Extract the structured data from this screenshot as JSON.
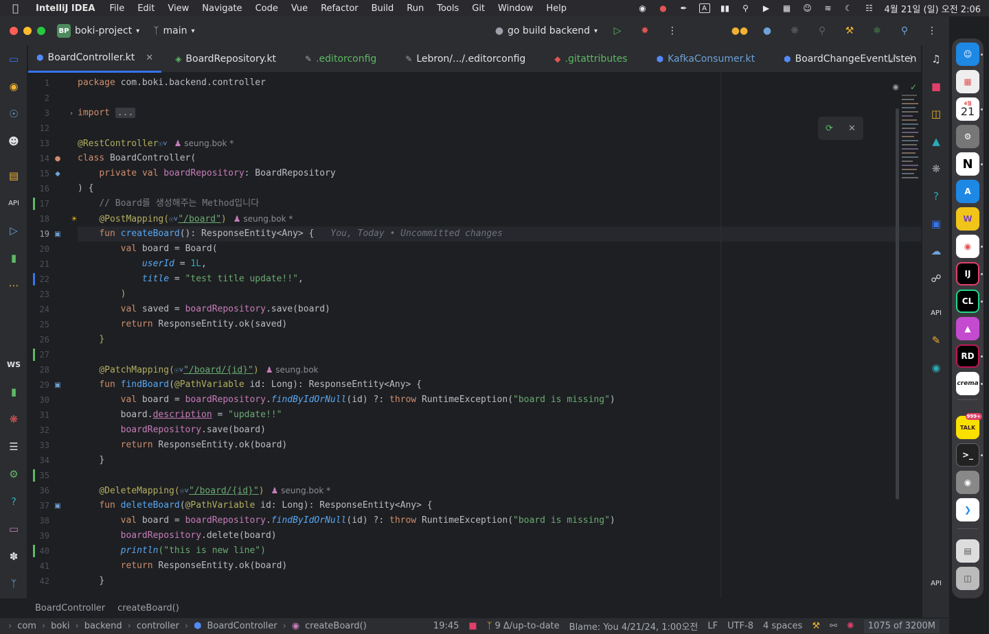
{
  "menubar": {
    "app_name": "IntelliJ IDEA",
    "items": [
      "File",
      "Edit",
      "View",
      "Navigate",
      "Code",
      "Vue",
      "Refactor",
      "Build",
      "Run",
      "Tools",
      "Git",
      "Window",
      "Help"
    ],
    "datetime": "4월 21일 (일) 오전 2:06"
  },
  "titlebar": {
    "project_badge": "BP",
    "project_name": "boki-project",
    "branch": "main",
    "run_config": "go build backend"
  },
  "tabs": [
    {
      "label": "BoardController.kt",
      "icon": "kotlin-class-icon",
      "active": true,
      "color": "#548af7"
    },
    {
      "label": "BoardRepository.kt",
      "icon": "kotlin-interface-icon",
      "active": false,
      "color": "#5fb865"
    },
    {
      "label": ".editorconfig",
      "icon": "editorconfig-icon",
      "active": false,
      "color": "#9da0a8"
    },
    {
      "label": "Lebron/.../.editorconfig",
      "icon": "editorconfig-icon",
      "active": false,
      "color": "#9da0a8"
    },
    {
      "label": ".gitattributes",
      "icon": "git-file-icon",
      "active": false,
      "color": "#e05555"
    },
    {
      "label": "KafkaConsumer.kt",
      "icon": "kotlin-class-icon",
      "active": false,
      "color": "#548af7"
    },
    {
      "label": "BoardChangeEventListen",
      "icon": "kotlin-class-icon",
      "active": false,
      "color": "#548af7"
    }
  ],
  "code": {
    "current_line": "19",
    "author": "seung.bok",
    "author_mod": "seung.bok *",
    "blame_inline": "You, Today • Uncommitted changes",
    "lines": [
      {
        "n": "1"
      },
      {
        "n": "2"
      },
      {
        "n": "3"
      },
      {
        "n": "12"
      },
      {
        "n": "13"
      },
      {
        "n": "14"
      },
      {
        "n": "15"
      },
      {
        "n": "16"
      },
      {
        "n": "17"
      },
      {
        "n": "18"
      },
      {
        "n": "19"
      },
      {
        "n": "20"
      },
      {
        "n": "21"
      },
      {
        "n": "22"
      },
      {
        "n": "23"
      },
      {
        "n": "24"
      },
      {
        "n": "25"
      },
      {
        "n": "26"
      },
      {
        "n": "27"
      },
      {
        "n": "28"
      },
      {
        "n": "29"
      },
      {
        "n": "30"
      },
      {
        "n": "31"
      },
      {
        "n": "32"
      },
      {
        "n": "33"
      },
      {
        "n": "34"
      },
      {
        "n": "35"
      },
      {
        "n": "36"
      },
      {
        "n": "37"
      },
      {
        "n": "38"
      },
      {
        "n": "39"
      },
      {
        "n": "40"
      },
      {
        "n": "41"
      },
      {
        "n": "42"
      }
    ],
    "t": {
      "package_kw": "package",
      "package_name": " com.boki.backend.controller",
      "import_kw": "import",
      "fold": "...",
      "rest_controller": "@RestController",
      "class_kw": "class",
      "class_name": " BoardController(",
      "private_kw": "private",
      "val_kw": "val",
      "repo_prop": "boardRepository",
      "repo_type": ": BoardRepository",
      "close_brace_open": ") {",
      "comment": "// Board를 생성해주는 Method입니다",
      "post_mapping": "@PostMapping(",
      "fun_kw": "fun",
      "create_board": "createBoard",
      "ret_type_any": "(): ResponseEntity<Any> {",
      "board_var": " board = ",
      "board_ctor": "Board(",
      "user_id": "userId",
      "eq": " = ",
      "num_1l": "1L",
      "title_param": "title",
      "title_str": "\"test title update!!\"",
      "comma": ",",
      "paren_close": ")",
      "saved_var": " saved = ",
      "save_call": ".save(board)",
      "return_kw": "return",
      "resp_ok_saved": " ResponseEntity.ok(saved)",
      "brace_close": "}",
      "patch_mapping": "@PatchMapping(",
      "path_board": "\"/board\"",
      "path_board_id": "\"/board/{id}\"",
      "find_board": "findBoard",
      "path_variable": "@PathVariable",
      "id_param": " id: Long): ResponseEntity<Any> {",
      "find_by_id": "findByIdOrNull",
      "find_args": "(id) ?: ",
      "throw_kw": "throw",
      "runtime_ex": " RuntimeException(",
      "board_missing": "\"board is missing\"",
      "board_desc_pre": "board.",
      "description": "description",
      "update_str": "\"update!!\"",
      "resp_ok_board": " ResponseEntity.ok(board)",
      "delete_mapping": "@DeleteMapping(",
      "delete_board": "deleteBoard",
      "delete_call": ".delete(board)",
      "println": "println",
      "new_line_str": "(\"this is new line\")",
      "close_paren_str": "\")",
      "open_paren_str": "(\"",
      "open_brace": "{"
    }
  },
  "breadcrumb_bar": {
    "class": "BoardController",
    "method": "createBoard()"
  },
  "status": {
    "path": [
      "com",
      "boki",
      "backend",
      "controller",
      "BoardController",
      "createBoard()"
    ],
    "position": "19:45",
    "git": "9 Δ/up-to-date",
    "blame": "Blame: You 4/21/24, 1:00오전",
    "line_sep": "LF",
    "encoding": "UTF-8",
    "indent": "4 spaces",
    "memory_used": "1075",
    "memory_total": "of 3200M"
  },
  "dock": {
    "calendar_month": "4월",
    "calendar_day": "21",
    "notion": "N",
    "intellij": "IJ",
    "clion": "CL",
    "rider": "RD",
    "crema": "crema",
    "kakao_badge": "999+",
    "kakao_label": "TALK"
  }
}
